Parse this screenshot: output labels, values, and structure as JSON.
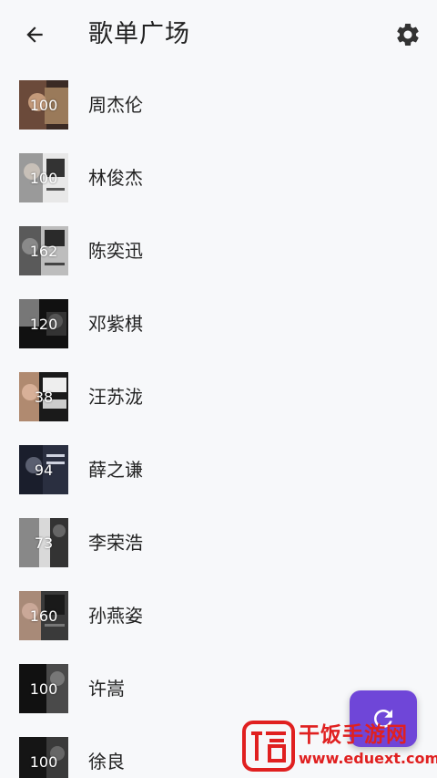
{
  "header": {
    "title": "歌单广场",
    "back_icon": "arrow-left-icon",
    "settings_icon": "gear-icon"
  },
  "artists": [
    {
      "name": "周杰伦",
      "count": "100"
    },
    {
      "name": "林俊杰",
      "count": "100"
    },
    {
      "name": "陈奕迅",
      "count": "162"
    },
    {
      "name": "邓紫棋",
      "count": "120"
    },
    {
      "name": "汪苏泷",
      "count": "38"
    },
    {
      "name": "薛之谦",
      "count": "94"
    },
    {
      "name": "李荣浩",
      "count": "73"
    },
    {
      "name": "孙燕姿",
      "count": "160"
    },
    {
      "name": "许嵩",
      "count": "100"
    },
    {
      "name": "徐良",
      "count": "100"
    }
  ],
  "fab": {
    "icon": "refresh-icon",
    "color": "#6f46d8"
  },
  "watermark": {
    "title": "干饭手游网",
    "url": "www.eduext.com",
    "color": "#e02020"
  }
}
